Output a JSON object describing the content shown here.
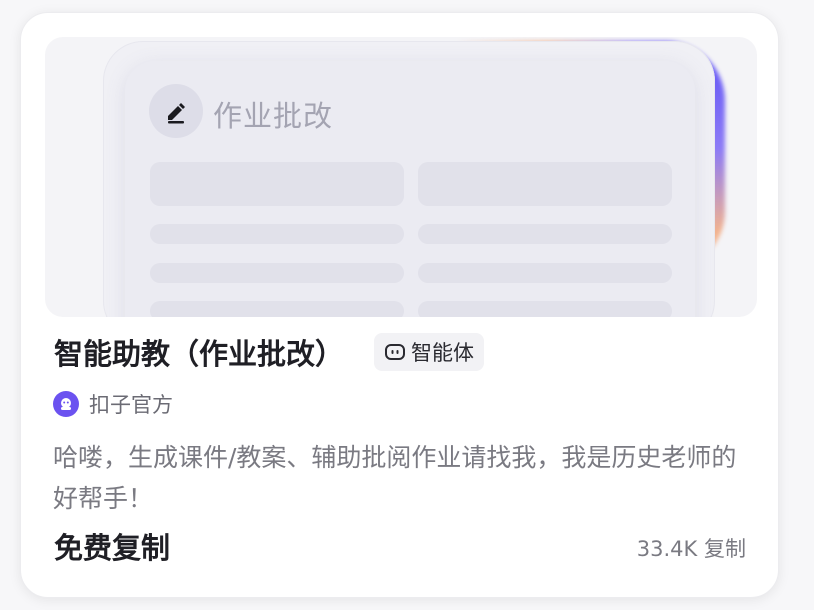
{
  "hero": {
    "title": "作业批改",
    "icon": "pencil-icon"
  },
  "card": {
    "title": "智能助教（作业批改）",
    "tag": {
      "label": "智能体",
      "icon": "bot-face-icon"
    },
    "author": {
      "name": "扣子官方",
      "icon": "official-avatar-icon"
    },
    "description": "哈喽，生成课件/教案、辅助批阅作业请找我，我是历史老师的好帮手！",
    "price": "免费复制",
    "copies": "33.4K 复制"
  },
  "colors": {
    "accent_purple": "#6b52f0",
    "accent_orange": "#f3b38e"
  }
}
